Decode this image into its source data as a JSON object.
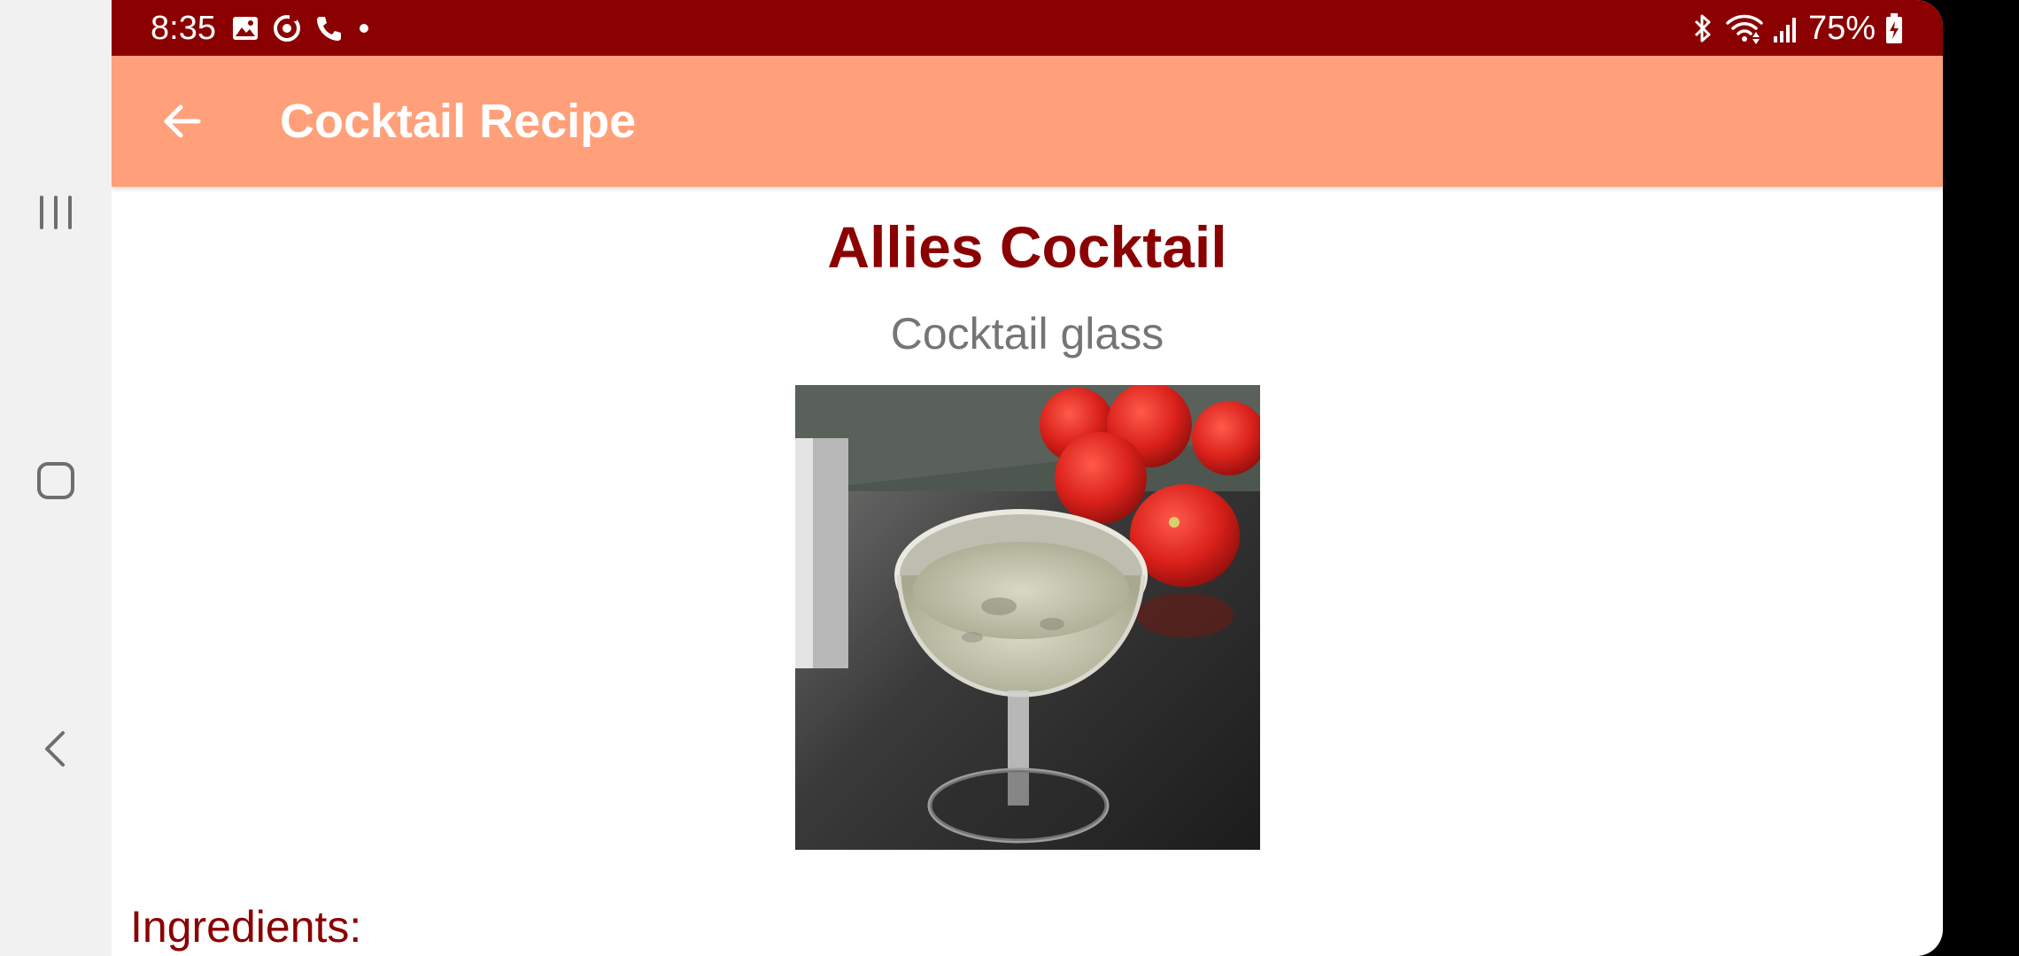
{
  "status_bar": {
    "time": "8:35",
    "left_icons": [
      "gallery-icon",
      "sync-icon",
      "phone-icon",
      "dot-icon"
    ],
    "right_icons": [
      "bluetooth-icon",
      "wifi-icon",
      "signal-icon",
      "battery-charging-icon"
    ],
    "battery": "75%"
  },
  "app_bar": {
    "title": "Cocktail Recipe",
    "back_icon": "arrow-back-icon"
  },
  "drink": {
    "name": "Allies Cocktail",
    "glass": "Cocktail glass",
    "image_alt": "cocktail-photo"
  },
  "sections": {
    "ingredients_label": "Ingredients:"
  },
  "nav_bar": {
    "recents": "recents-icon",
    "home": "home-icon",
    "back": "back-icon"
  },
  "colors": {
    "status_bar": "#8b0000",
    "app_bar": "#ffa07a",
    "accent": "#8b0000",
    "secondary_text": "#757575"
  }
}
